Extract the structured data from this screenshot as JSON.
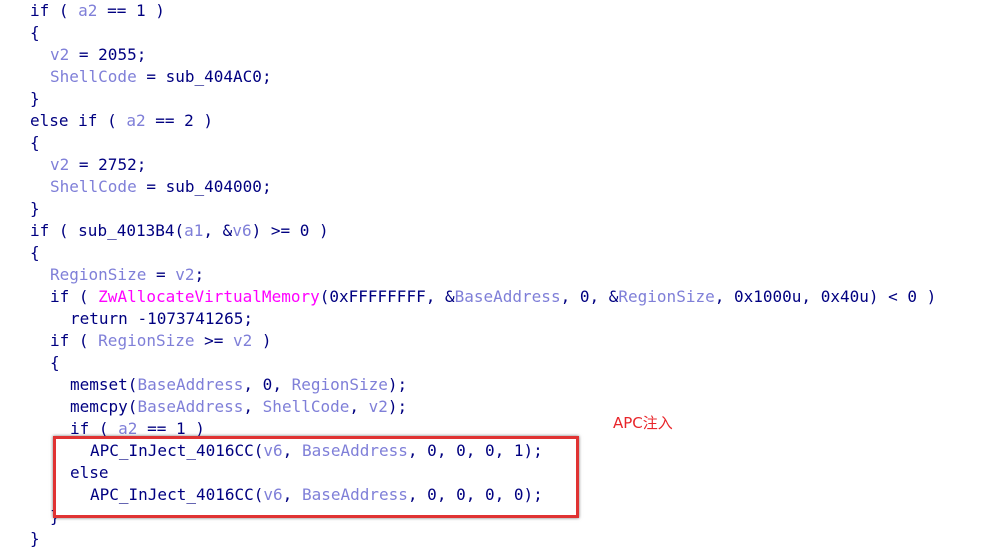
{
  "colors": {
    "text": "#000080",
    "variable": "#7f7fd8",
    "api": "#ff00ff",
    "annotation": "#e8252a",
    "box": "#e03333"
  },
  "annotation": {
    "text": "APC注入"
  },
  "code": {
    "lines": [
      {
        "indent": 0,
        "tokens": [
          [
            "kw",
            "if"
          ],
          [
            "punct",
            " ( "
          ],
          [
            "var",
            "a2"
          ],
          [
            "punct",
            " == "
          ],
          [
            "num",
            "1"
          ],
          [
            "punct",
            " )"
          ]
        ]
      },
      {
        "indent": 0,
        "tokens": [
          [
            "punct",
            "{"
          ]
        ]
      },
      {
        "indent": 1,
        "tokens": [
          [
            "var",
            "v2"
          ],
          [
            "punct",
            " = "
          ],
          [
            "num",
            "2055"
          ],
          [
            "punct",
            ";"
          ]
        ]
      },
      {
        "indent": 1,
        "tokens": [
          [
            "var",
            "ShellCode"
          ],
          [
            "punct",
            " = "
          ],
          [
            "plain",
            "sub_404AC0"
          ],
          [
            "punct",
            ";"
          ]
        ]
      },
      {
        "indent": 0,
        "tokens": [
          [
            "punct",
            "}"
          ]
        ]
      },
      {
        "indent": 0,
        "tokens": [
          [
            "kw",
            "else if"
          ],
          [
            "punct",
            " ( "
          ],
          [
            "var",
            "a2"
          ],
          [
            "punct",
            " == "
          ],
          [
            "num",
            "2"
          ],
          [
            "punct",
            " )"
          ]
        ]
      },
      {
        "indent": 0,
        "tokens": [
          [
            "punct",
            "{"
          ]
        ]
      },
      {
        "indent": 1,
        "tokens": [
          [
            "var",
            "v2"
          ],
          [
            "punct",
            " = "
          ],
          [
            "num",
            "2752"
          ],
          [
            "punct",
            ";"
          ]
        ]
      },
      {
        "indent": 1,
        "tokens": [
          [
            "var",
            "ShellCode"
          ],
          [
            "punct",
            " = "
          ],
          [
            "plain",
            "sub_404000"
          ],
          [
            "punct",
            ";"
          ]
        ]
      },
      {
        "indent": 0,
        "tokens": [
          [
            "punct",
            "}"
          ]
        ]
      },
      {
        "indent": 0,
        "tokens": [
          [
            "kw",
            "if"
          ],
          [
            "punct",
            " ( "
          ],
          [
            "plain",
            "sub_4013B4"
          ],
          [
            "punct",
            "("
          ],
          [
            "var",
            "a1"
          ],
          [
            "punct",
            ", &"
          ],
          [
            "var",
            "v6"
          ],
          [
            "punct",
            ") >= "
          ],
          [
            "num",
            "0"
          ],
          [
            "punct",
            " )"
          ]
        ]
      },
      {
        "indent": 0,
        "tokens": [
          [
            "punct",
            "{"
          ]
        ]
      },
      {
        "indent": 1,
        "tokens": [
          [
            "var",
            "RegionSize"
          ],
          [
            "punct",
            " = "
          ],
          [
            "var",
            "v2"
          ],
          [
            "punct",
            ";"
          ]
        ]
      },
      {
        "indent": 1,
        "tokens": [
          [
            "kw",
            "if"
          ],
          [
            "punct",
            " ( "
          ],
          [
            "api",
            "ZwAllocateVirtualMemory"
          ],
          [
            "punct",
            "("
          ],
          [
            "num",
            "0xFFFFFFFF"
          ],
          [
            "punct",
            ", &"
          ],
          [
            "var",
            "BaseAddress"
          ],
          [
            "punct",
            ", "
          ],
          [
            "num",
            "0"
          ],
          [
            "punct",
            ", &"
          ],
          [
            "var",
            "RegionSize"
          ],
          [
            "punct",
            ", "
          ],
          [
            "num",
            "0x1000u"
          ],
          [
            "punct",
            ", "
          ],
          [
            "num",
            "0x40u"
          ],
          [
            "punct",
            ") < "
          ],
          [
            "num",
            "0"
          ],
          [
            "punct",
            " )"
          ]
        ]
      },
      {
        "indent": 2,
        "tokens": [
          [
            "kw",
            "return"
          ],
          [
            "punct",
            " "
          ],
          [
            "num",
            "-1073741265"
          ],
          [
            "punct",
            ";"
          ]
        ]
      },
      {
        "indent": 1,
        "tokens": [
          [
            "kw",
            "if"
          ],
          [
            "punct",
            " ( "
          ],
          [
            "var",
            "RegionSize"
          ],
          [
            "punct",
            " >= "
          ],
          [
            "var",
            "v2"
          ],
          [
            "punct",
            " )"
          ]
        ]
      },
      {
        "indent": 1,
        "tokens": [
          [
            "punct",
            "{"
          ]
        ]
      },
      {
        "indent": 2,
        "tokens": [
          [
            "plain",
            "memset"
          ],
          [
            "punct",
            "("
          ],
          [
            "var",
            "BaseAddress"
          ],
          [
            "punct",
            ", "
          ],
          [
            "num",
            "0"
          ],
          [
            "punct",
            ", "
          ],
          [
            "var",
            "RegionSize"
          ],
          [
            "punct",
            ");"
          ]
        ]
      },
      {
        "indent": 2,
        "tokens": [
          [
            "plain",
            "memcpy"
          ],
          [
            "punct",
            "("
          ],
          [
            "var",
            "BaseAddress"
          ],
          [
            "punct",
            ", "
          ],
          [
            "var",
            "ShellCode"
          ],
          [
            "punct",
            ", "
          ],
          [
            "var",
            "v2"
          ],
          [
            "punct",
            ");"
          ]
        ]
      },
      {
        "indent": 2,
        "tokens": [
          [
            "kw",
            "if"
          ],
          [
            "punct",
            " ( "
          ],
          [
            "var",
            "a2"
          ],
          [
            "punct",
            " == "
          ],
          [
            "num",
            "1"
          ],
          [
            "punct",
            " )"
          ]
        ]
      },
      {
        "indent": 3,
        "tokens": [
          [
            "plain",
            "APC_InJect_4016CC"
          ],
          [
            "punct",
            "("
          ],
          [
            "var",
            "v6"
          ],
          [
            "punct",
            ", "
          ],
          [
            "var",
            "BaseAddress"
          ],
          [
            "punct",
            ", "
          ],
          [
            "num",
            "0"
          ],
          [
            "punct",
            ", "
          ],
          [
            "num",
            "0"
          ],
          [
            "punct",
            ", "
          ],
          [
            "num",
            "0"
          ],
          [
            "punct",
            ", "
          ],
          [
            "num",
            "1"
          ],
          [
            "punct",
            ");"
          ]
        ]
      },
      {
        "indent": 2,
        "tokens": [
          [
            "kw",
            "else"
          ]
        ]
      },
      {
        "indent": 3,
        "tokens": [
          [
            "plain",
            "APC_InJect_4016CC"
          ],
          [
            "punct",
            "("
          ],
          [
            "var",
            "v6"
          ],
          [
            "punct",
            ", "
          ],
          [
            "var",
            "BaseAddress"
          ],
          [
            "punct",
            ", "
          ],
          [
            "num",
            "0"
          ],
          [
            "punct",
            ", "
          ],
          [
            "num",
            "0"
          ],
          [
            "punct",
            ", "
          ],
          [
            "num",
            "0"
          ],
          [
            "punct",
            ", "
          ],
          [
            "num",
            "0"
          ],
          [
            "punct",
            ");"
          ]
        ]
      },
      {
        "indent": 1,
        "tokens": [
          [
            "punct",
            "}"
          ]
        ]
      },
      {
        "indent": 0,
        "tokens": [
          [
            "punct",
            "}"
          ]
        ]
      }
    ]
  }
}
